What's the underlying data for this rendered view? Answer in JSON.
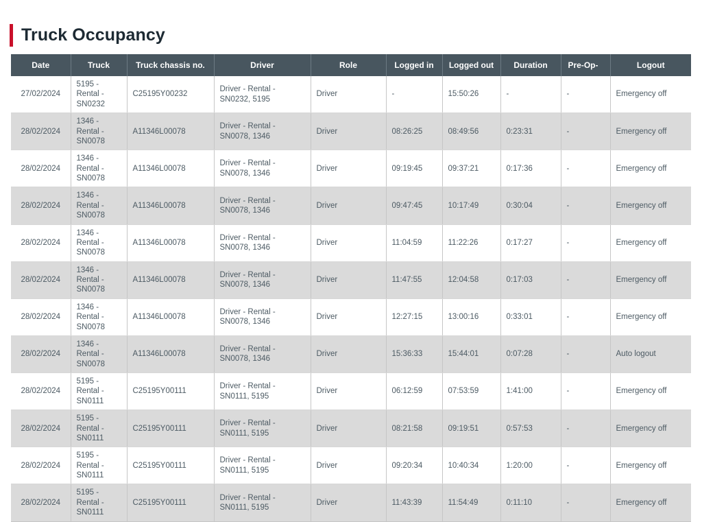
{
  "page": {
    "title": "Truck Occupancy",
    "accent_color": "#c9102a",
    "header_bg": "#48565f",
    "stripe_color": "#dadada"
  },
  "table": {
    "columns": [
      {
        "key": "date",
        "label": "Date",
        "align": "center"
      },
      {
        "key": "truck",
        "label": "Truck",
        "align": "center"
      },
      {
        "key": "chassis",
        "label": "Truck chassis no.",
        "align": "center"
      },
      {
        "key": "driver",
        "label": "Driver",
        "align": "center"
      },
      {
        "key": "role",
        "label": "Role",
        "align": "center"
      },
      {
        "key": "login",
        "label": "Logged in",
        "align": "center"
      },
      {
        "key": "logout",
        "label": "Logged out",
        "align": "center"
      },
      {
        "key": "duration",
        "label": "Duration",
        "align": "center"
      },
      {
        "key": "preop",
        "label": "Pre-Op-",
        "align": "left"
      },
      {
        "key": "logoutr",
        "label": "Logout",
        "align": "center"
      }
    ],
    "rows": [
      {
        "date": "27/02/2024",
        "truck": "5195 - Rental - SN0232",
        "chassis": "C25195Y00232",
        "driver": "Driver - Rental - SN0232, 5195",
        "role": "Driver",
        "login": "-",
        "logout": "15:50:26",
        "duration": "-",
        "preop": "-",
        "logoutr": "Emergency off"
      },
      {
        "date": "28/02/2024",
        "truck": "1346 - Rental - SN0078",
        "chassis": "A11346L00078",
        "driver": "Driver - Rental - SN0078, 1346",
        "role": "Driver",
        "login": "08:26:25",
        "logout": "08:49:56",
        "duration": "0:23:31",
        "preop": "-",
        "logoutr": "Emergency off"
      },
      {
        "date": "28/02/2024",
        "truck": "1346 - Rental - SN0078",
        "chassis": "A11346L00078",
        "driver": "Driver - Rental - SN0078, 1346",
        "role": "Driver",
        "login": "09:19:45",
        "logout": "09:37:21",
        "duration": "0:17:36",
        "preop": "-",
        "logoutr": "Emergency off"
      },
      {
        "date": "28/02/2024",
        "truck": "1346 - Rental - SN0078",
        "chassis": "A11346L00078",
        "driver": "Driver - Rental - SN0078, 1346",
        "role": "Driver",
        "login": "09:47:45",
        "logout": "10:17:49",
        "duration": "0:30:04",
        "preop": "-",
        "logoutr": "Emergency off"
      },
      {
        "date": "28/02/2024",
        "truck": "1346 - Rental - SN0078",
        "chassis": "A11346L00078",
        "driver": "Driver - Rental - SN0078, 1346",
        "role": "Driver",
        "login": "11:04:59",
        "logout": "11:22:26",
        "duration": "0:17:27",
        "preop": "-",
        "logoutr": "Emergency off"
      },
      {
        "date": "28/02/2024",
        "truck": "1346 - Rental - SN0078",
        "chassis": "A11346L00078",
        "driver": "Driver - Rental - SN0078, 1346",
        "role": "Driver",
        "login": "11:47:55",
        "logout": "12:04:58",
        "duration": "0:17:03",
        "preop": "-",
        "logoutr": "Emergency off"
      },
      {
        "date": "28/02/2024",
        "truck": "1346 - Rental - SN0078",
        "chassis": "A11346L00078",
        "driver": "Driver - Rental - SN0078, 1346",
        "role": "Driver",
        "login": "12:27:15",
        "logout": "13:00:16",
        "duration": "0:33:01",
        "preop": "-",
        "logoutr": "Emergency off"
      },
      {
        "date": "28/02/2024",
        "truck": "1346 - Rental - SN0078",
        "chassis": "A11346L00078",
        "driver": "Driver - Rental - SN0078, 1346",
        "role": "Driver",
        "login": "15:36:33",
        "logout": "15:44:01",
        "duration": "0:07:28",
        "preop": "-",
        "logoutr": "Auto logout"
      },
      {
        "date": "28/02/2024",
        "truck": "5195 - Rental - SN0111",
        "chassis": "C25195Y00111",
        "driver": "Driver - Rental - SN0111, 5195",
        "role": "Driver",
        "login": "06:12:59",
        "logout": "07:53:59",
        "duration": "1:41:00",
        "preop": "-",
        "logoutr": "Emergency off"
      },
      {
        "date": "28/02/2024",
        "truck": "5195 - Rental - SN0111",
        "chassis": "C25195Y00111",
        "driver": "Driver - Rental - SN0111, 5195",
        "role": "Driver",
        "login": "08:21:58",
        "logout": "09:19:51",
        "duration": "0:57:53",
        "preop": "-",
        "logoutr": "Emergency off"
      },
      {
        "date": "28/02/2024",
        "truck": "5195 - Rental - SN0111",
        "chassis": "C25195Y00111",
        "driver": "Driver - Rental - SN0111, 5195",
        "role": "Driver",
        "login": "09:20:34",
        "logout": "10:40:34",
        "duration": "1:20:00",
        "preop": "-",
        "logoutr": "Emergency off"
      },
      {
        "date": "28/02/2024",
        "truck": "5195 - Rental - SN0111",
        "chassis": "C25195Y00111",
        "driver": "Driver - Rental - SN0111, 5195",
        "role": "Driver",
        "login": "11:43:39",
        "logout": "11:54:49",
        "duration": "0:11:10",
        "preop": "-",
        "logoutr": "Emergency off"
      }
    ]
  }
}
